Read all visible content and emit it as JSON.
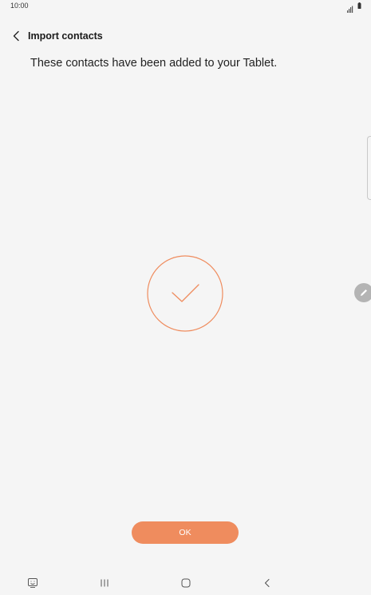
{
  "status_bar": {
    "time": "10:00",
    "icons": [
      "signal-icon",
      "battery-icon"
    ]
  },
  "header": {
    "back_icon": "chevron-left-icon",
    "title": "Import contacts"
  },
  "main": {
    "message": "These contacts have been added to your Tablet.",
    "success_icon": "checkmark-circle-icon",
    "ok_label": "OK"
  },
  "floating": {
    "edit_icon": "pencil-icon"
  },
  "nav_bar": {
    "items": [
      "keyboard-icon",
      "recents-icon",
      "home-icon",
      "back-icon"
    ]
  },
  "colors": {
    "accent": "#ef8c5e",
    "background": "#f5f5f5"
  }
}
